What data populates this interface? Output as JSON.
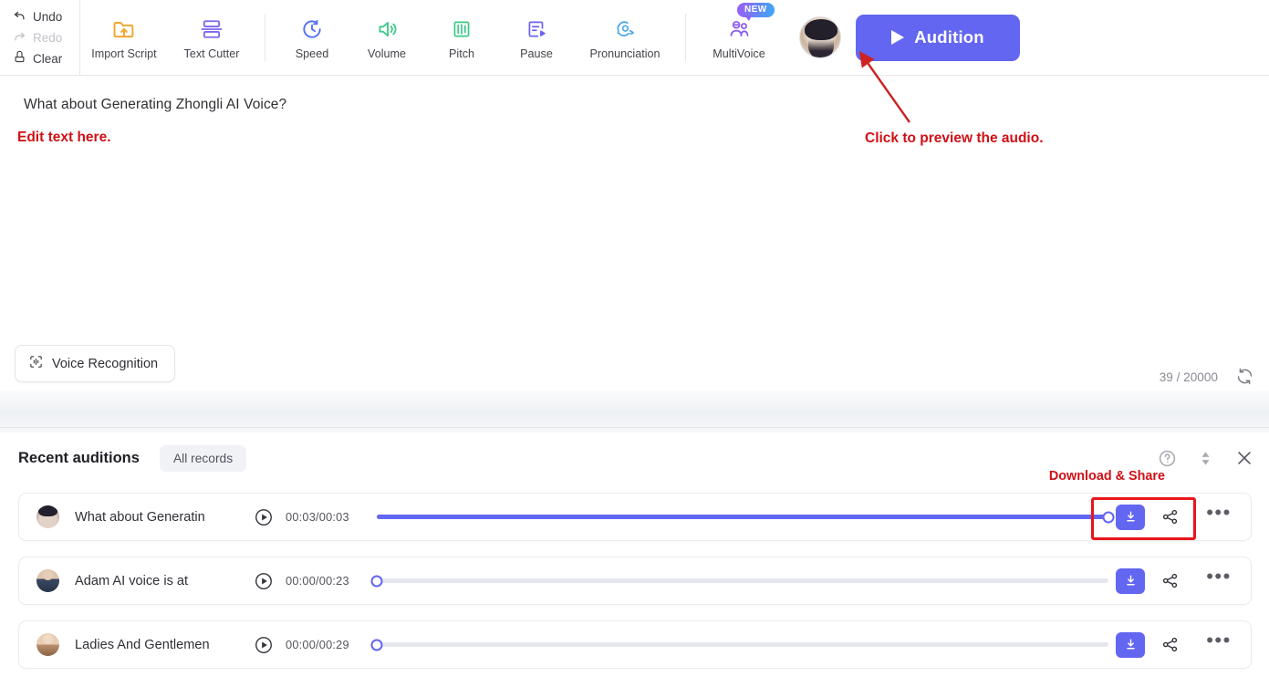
{
  "toolbar": {
    "history": [
      {
        "label": "Undo",
        "icon": "undo-icon",
        "disabled": false
      },
      {
        "label": "Redo",
        "icon": "redo-icon",
        "disabled": true
      },
      {
        "label": "Clear",
        "icon": "clear-brush-icon",
        "disabled": false
      }
    ],
    "tools": [
      {
        "label": "Import Script",
        "icon": "import-script-icon"
      },
      {
        "label": "Text Cutter",
        "icon": "text-cutter-icon"
      },
      {
        "label": "Speed",
        "icon": "speed-icon"
      },
      {
        "label": "Volume",
        "icon": "volume-icon"
      },
      {
        "label": "Pitch",
        "icon": "pitch-icon"
      },
      {
        "label": "Pause",
        "icon": "pause-insert-icon"
      },
      {
        "label": "Pronunciation",
        "icon": "pronunciation-icon"
      },
      {
        "label": "MultiVoice",
        "icon": "multivoice-icon",
        "badge": "NEW"
      }
    ],
    "avatar_name": "speaker-avatar",
    "audition_label": "Audition"
  },
  "editor": {
    "script_text": "What about Generating Zhongli AI Voice?",
    "voice_recognition_label": "Voice Recognition",
    "char_count": "39",
    "char_limit": "20000",
    "counter_text": "39 / 20000"
  },
  "annotations": {
    "edit_text": "Edit text here.",
    "preview_text": "Click to preview the audio.",
    "download_share": "Download & Share",
    "color": "#cf1116"
  },
  "panel": {
    "title": "Recent auditions",
    "all_records_label": "All records",
    "actions": [
      {
        "name": "help-icon"
      },
      {
        "name": "sort-icon"
      },
      {
        "name": "close-icon"
      }
    ]
  },
  "auditions": [
    {
      "name": "What about Generatin",
      "time": "00:03/00:03",
      "progress": 100,
      "avatar": "av-a",
      "download_label": "download-icon",
      "share_label": "share-icon",
      "more_label": "•••"
    },
    {
      "name": "Adam AI voice is at",
      "time": "00:00/00:23",
      "progress": 0,
      "avatar": "av-b",
      "download_label": "download-icon",
      "share_label": "share-icon",
      "more_label": "•••"
    },
    {
      "name": "Ladies And Gentlemen",
      "time": "00:00/00:29",
      "progress": 0,
      "avatar": "av-c",
      "download_label": "download-icon",
      "share_label": "share-icon",
      "more_label": "•••"
    }
  ],
  "colors": {
    "accent": "#6366f1",
    "annotation_red": "#cf1116",
    "highlight_red": "#e8161b",
    "track": "#e6e7ee"
  }
}
